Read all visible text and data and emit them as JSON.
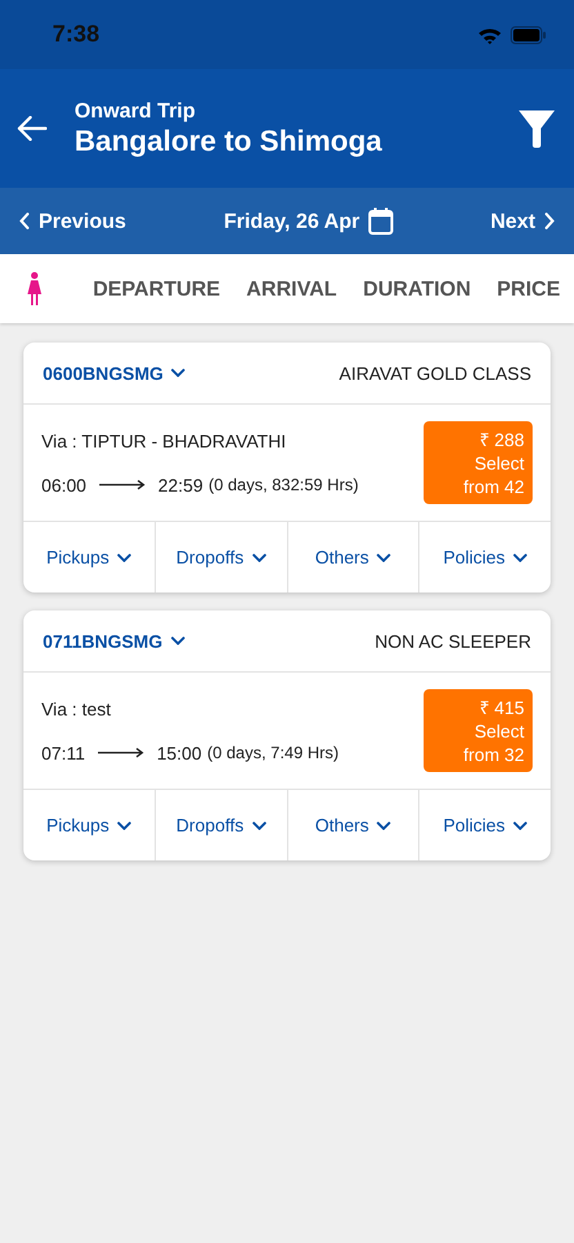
{
  "status_bar": {
    "time": "7:38"
  },
  "header": {
    "subtitle": "Onward Trip",
    "title": "Bangalore to Shimoga"
  },
  "date_bar": {
    "previous": "Previous",
    "date": "Friday, 26 Apr",
    "next": "Next"
  },
  "sort_options": [
    "DEPARTURE",
    "ARRIVAL",
    "DURATION",
    "PRICE"
  ],
  "trips": [
    {
      "code": "0600BNGSMG",
      "bus_type": "AIRAVAT GOLD CLASS",
      "via": "Via : TIPTUR - BHADRAVATHI",
      "depart": "06:00",
      "arrive": "22:59",
      "duration": "(0 days, 832:59 Hrs)",
      "price": "₹ 288",
      "select": "Select",
      "seats": "from 42",
      "actions": [
        "Pickups",
        "Dropoffs",
        "Others",
        "Policies"
      ]
    },
    {
      "code": "0711BNGSMG",
      "bus_type": "NON AC SLEEPER",
      "via": "Via : test",
      "depart": "07:11",
      "arrive": "15:00",
      "duration": "(0 days, 7:49 Hrs)",
      "price": "₹ 415",
      "select": "Select",
      "seats": "from 32",
      "actions": [
        "Pickups",
        "Dropoffs",
        "Others",
        "Policies"
      ]
    }
  ]
}
